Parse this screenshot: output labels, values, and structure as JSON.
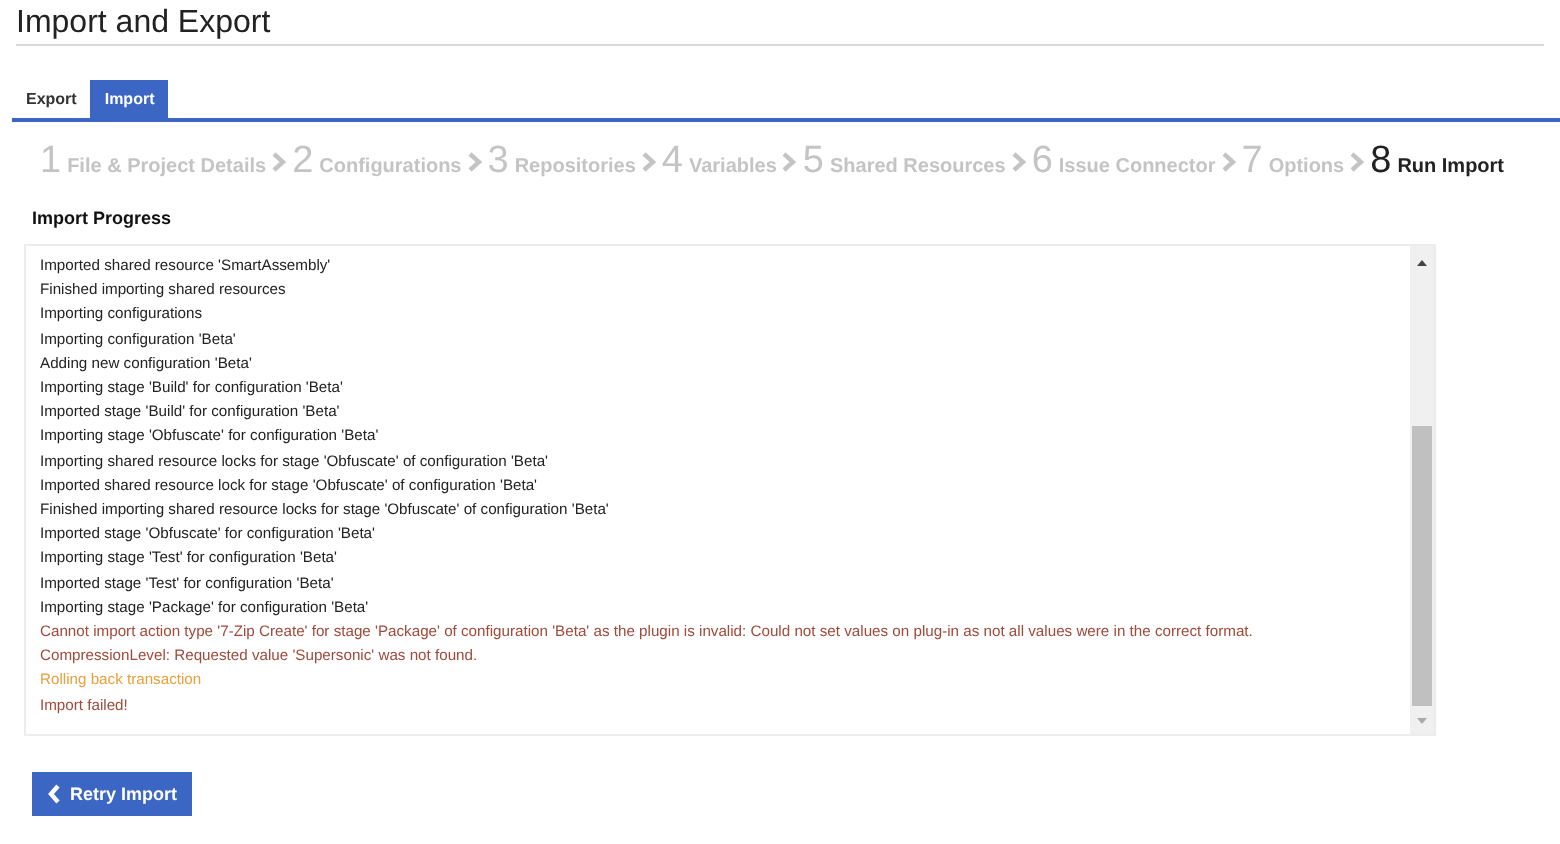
{
  "page": {
    "title": "Import and Export"
  },
  "tabs": [
    {
      "label": "Export",
      "selected": false
    },
    {
      "label": "Import",
      "selected": true
    }
  ],
  "steps": [
    {
      "number": "1",
      "label": "File & Project Details",
      "selected": false
    },
    {
      "number": "2",
      "label": "Configurations",
      "selected": false
    },
    {
      "number": "3",
      "label": "Repositories",
      "selected": false
    },
    {
      "number": "4",
      "label": "Variables",
      "selected": false
    },
    {
      "number": "5",
      "label": "Shared Resources",
      "selected": false
    },
    {
      "number": "6",
      "label": "Issue Connector",
      "selected": false
    },
    {
      "number": "7",
      "label": "Options",
      "selected": false
    },
    {
      "number": "8",
      "label": "Run Import",
      "selected": true
    }
  ],
  "progress": {
    "heading": "Import Progress",
    "log": [
      {
        "kind": "info",
        "text": "Imported shared resource 'SmartAssembly'"
      },
      {
        "kind": "info",
        "text": "Finished importing shared resources"
      },
      {
        "kind": "info",
        "text": "Importing configurations"
      },
      {
        "kind": "info",
        "text": "Importing configuration 'Beta'"
      },
      {
        "kind": "info",
        "text": "Adding new configuration 'Beta'"
      },
      {
        "kind": "info",
        "text": "Importing stage 'Build' for configuration 'Beta'"
      },
      {
        "kind": "info",
        "text": "Imported stage 'Build' for configuration 'Beta'"
      },
      {
        "kind": "info",
        "text": "Importing stage 'Obfuscate' for configuration 'Beta'"
      },
      {
        "kind": "info",
        "text": "Importing shared resource locks for stage 'Obfuscate' of configuration 'Beta'"
      },
      {
        "kind": "info",
        "text": "Imported shared resource lock for stage 'Obfuscate' of configuration 'Beta'"
      },
      {
        "kind": "info",
        "text": "Finished importing shared resource locks for stage 'Obfuscate' of configuration 'Beta'"
      },
      {
        "kind": "info",
        "text": "Imported stage 'Obfuscate' for configuration 'Beta'"
      },
      {
        "kind": "info",
        "text": "Importing stage 'Test' for configuration 'Beta'"
      },
      {
        "kind": "info",
        "text": "Imported stage 'Test' for configuration 'Beta'"
      },
      {
        "kind": "info",
        "text": "Importing stage 'Package' for configuration 'Beta'"
      },
      {
        "kind": "error",
        "text": "Cannot import action type '7-Zip Create' for stage 'Package' of configuration 'Beta' as the plugin is invalid: Could not set values on plug-in as not all values were in the correct format."
      },
      {
        "kind": "error",
        "text": "CompressionLevel: Requested value 'Supersonic' was not found."
      },
      {
        "kind": "warning",
        "text": "Rolling back transaction"
      },
      {
        "kind": "error",
        "text": "Import failed!"
      }
    ]
  },
  "retry_button": {
    "label": "Retry Import"
  }
}
